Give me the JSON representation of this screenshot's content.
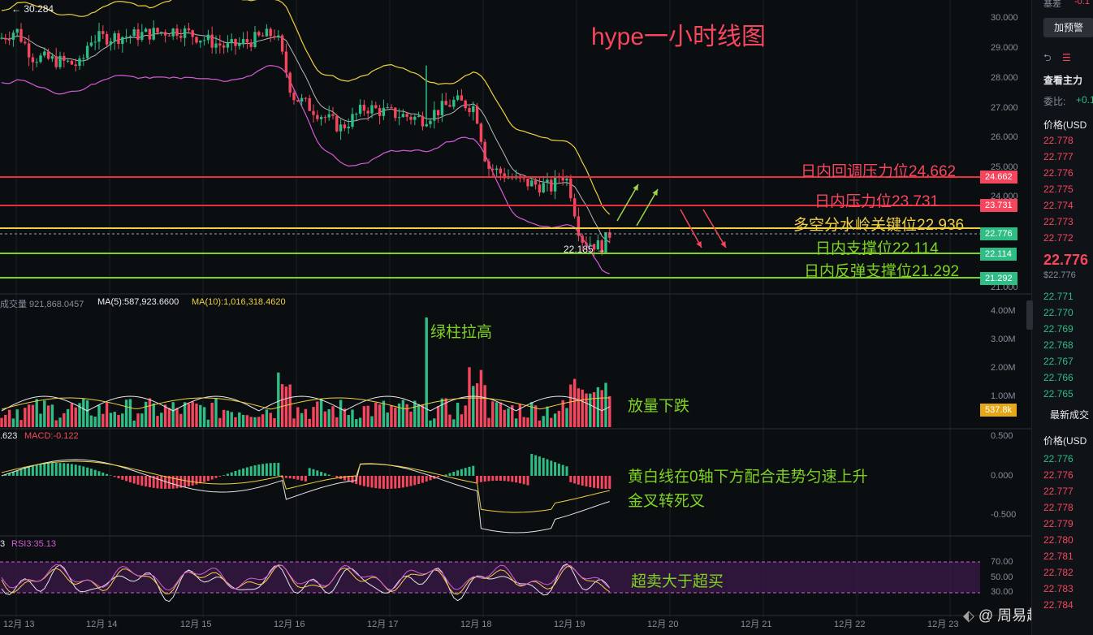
{
  "title": "hype一小时线图",
  "price_axis": [
    "30.000",
    "29.000",
    "28.000",
    "27.000",
    "26.000",
    "25.000",
    "24.000",
    "21.000"
  ],
  "price_tags": {
    "r1": "24.662",
    "r2": "23.731",
    "cur": "22.776",
    "s1": "22.114",
    "s2": "21.292"
  },
  "annotations": {
    "r1": "日内回调压力位24.662",
    "r2": "日内压力位23.731",
    "pivot": "多空分水岭关键位22.936",
    "s1": "日内支撑位22.114",
    "s2": "日内反弹支撑位21.292",
    "vol_spike": "绿柱拉高",
    "vol_down": "放量下跌",
    "macd_note1": "黄白线在0轴下方配合走势匀速上升",
    "macd_note2": "金叉转死叉",
    "rsi_note": "超卖大于超买"
  },
  "high_label": "30.284",
  "low_label": "22.185",
  "volume_legend": {
    "a": "成交量 921,868.0457",
    "b": "MA(5):587,923.6600",
    "c": "MA(10):1,016,318.4620"
  },
  "volume_axis": [
    "4.00M",
    "3.00M",
    "2.00M",
    "1.00M"
  ],
  "volume_tag": "537.8k",
  "macd_legend": {
    "a": ".623",
    "b": "MACD:-0.122"
  },
  "macd_axis": [
    "0.500",
    "0.000",
    "-0.500"
  ],
  "rsi_legend": {
    "a": "3",
    "b": "RSI3:35.13"
  },
  "rsi_axis": [
    "70.00",
    "50.00",
    "30.00"
  ],
  "dates": [
    "12月 13",
    "12月 14",
    "12月 15",
    "12月 16",
    "12月 17",
    "12月 18",
    "12月 19",
    "12月 20",
    "12月 21",
    "12月 22",
    "12月 23"
  ],
  "right_panel": {
    "button": "加预警",
    "top_labels": [
      "基差",
      "-0.1"
    ],
    "sec1": "查看主力",
    "ratio": "委比:",
    "ratio_val": "+0.1",
    "price_head": "价格(USD",
    "asks": [
      "22.778",
      "22.777",
      "22.776",
      "22.775",
      "22.774",
      "22.773",
      "22.772"
    ],
    "last": "22.776",
    "last_usd": "$22.776",
    "bids": [
      "22.771",
      "22.770",
      "22.769",
      "22.768",
      "22.767",
      "22.766",
      "22.765"
    ],
    "trades_head": "最新成交",
    "trades_price_head": "价格(USD",
    "trades": [
      "22.776",
      "22.776",
      "22.777",
      "22.778",
      "22.779",
      "22.780",
      "22.781",
      "22.782",
      "22.783",
      "22.784"
    ]
  },
  "watermark": "@ 周易趋势",
  "colors": {
    "up": "#2ebd85",
    "down": "#f6465d",
    "yellow": "#f0d040",
    "orange": "#e6b422"
  }
}
